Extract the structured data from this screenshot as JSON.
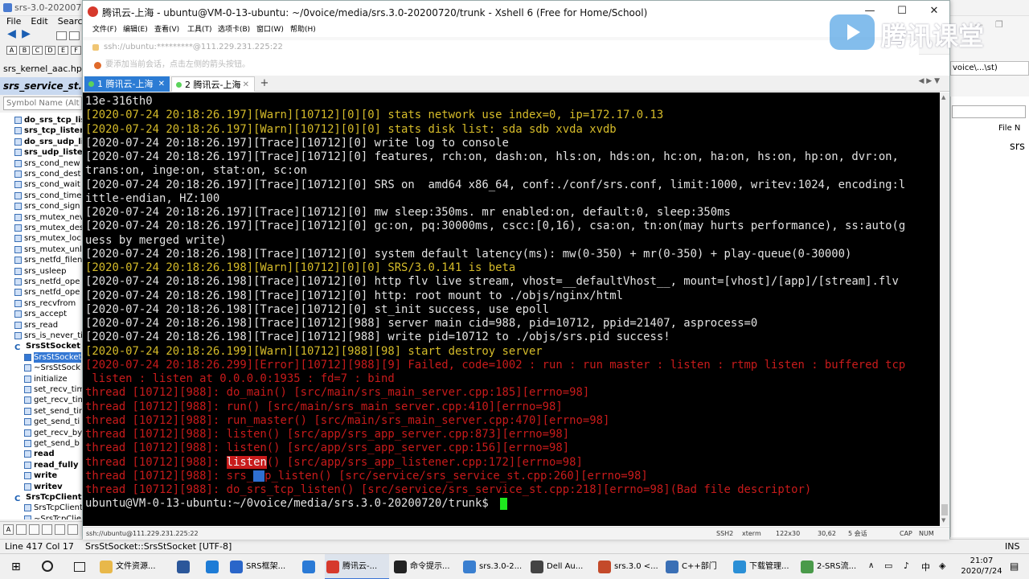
{
  "background_app": {
    "title": "srs-3.0-20200720",
    "menu": [
      "File",
      "Edit",
      "Searc"
    ],
    "file_tab": "srs_kernel_aac.hpp",
    "current_tab": "srs_service_st.cp",
    "symbol_search_placeholder": "Symbol Name (Alt",
    "symbols": [
      {
        "label": "do_srs_tcp_list",
        "bold": true,
        "kind": "fn"
      },
      {
        "label": "srs_tcp_listen",
        "bold": true,
        "kind": "fn"
      },
      {
        "label": "do_srs_udp_lis",
        "bold": true,
        "kind": "fn"
      },
      {
        "label": "srs_udp_listen",
        "bold": true,
        "kind": "fn"
      },
      {
        "label": "srs_cond_new",
        "bold": false,
        "kind": "fn"
      },
      {
        "label": "srs_cond_dest",
        "bold": false,
        "kind": "fn"
      },
      {
        "label": "srs_cond_wait",
        "bold": false,
        "kind": "fn"
      },
      {
        "label": "srs_cond_time",
        "bold": false,
        "kind": "fn"
      },
      {
        "label": "srs_cond_sign",
        "bold": false,
        "kind": "fn"
      },
      {
        "label": "srs_mutex_nev",
        "bold": false,
        "kind": "fn"
      },
      {
        "label": "srs_mutex_des",
        "bold": false,
        "kind": "fn"
      },
      {
        "label": "srs_mutex_loc",
        "bold": false,
        "kind": "fn"
      },
      {
        "label": "srs_mutex_unl",
        "bold": false,
        "kind": "fn"
      },
      {
        "label": "srs_netfd_filen",
        "bold": false,
        "kind": "fn"
      },
      {
        "label": "srs_usleep",
        "bold": false,
        "kind": "fn"
      },
      {
        "label": "srs_netfd_ope",
        "bold": false,
        "kind": "fn"
      },
      {
        "label": "srs_netfd_ope",
        "bold": false,
        "kind": "fn"
      },
      {
        "label": "srs_recvfrom",
        "bold": false,
        "kind": "fn"
      },
      {
        "label": "srs_accept",
        "bold": false,
        "kind": "fn"
      },
      {
        "label": "srs_read",
        "bold": false,
        "kind": "fn"
      },
      {
        "label": "srs_is_never_ti",
        "bold": false,
        "kind": "fn"
      },
      {
        "label": "SrsStSocket",
        "bold": true,
        "kind": "class"
      },
      {
        "label": "SrsStSocket",
        "bold": false,
        "kind": "member",
        "selected": true
      },
      {
        "label": "~SrsStSock",
        "bold": false,
        "kind": "member"
      },
      {
        "label": "initialize",
        "bold": false,
        "kind": "member"
      },
      {
        "label": "set_recv_tim",
        "bold": false,
        "kind": "member"
      },
      {
        "label": "get_recv_tim",
        "bold": false,
        "kind": "member"
      },
      {
        "label": "set_send_tim",
        "bold": false,
        "kind": "member"
      },
      {
        "label": "get_send_ti",
        "bold": false,
        "kind": "member"
      },
      {
        "label": "get_recv_by",
        "bold": false,
        "kind": "member"
      },
      {
        "label": "get_send_b",
        "bold": false,
        "kind": "member"
      },
      {
        "label": "read",
        "bold": true,
        "kind": "member"
      },
      {
        "label": "read_fully",
        "bold": true,
        "kind": "member"
      },
      {
        "label": "write",
        "bold": true,
        "kind": "member"
      },
      {
        "label": "writev",
        "bold": true,
        "kind": "member"
      },
      {
        "label": "SrsTcpClient",
        "bold": true,
        "kind": "class"
      },
      {
        "label": "SrsTcpClient",
        "bold": false,
        "kind": "member"
      },
      {
        "label": "~SrsTcpClie",
        "bold": false,
        "kind": "member"
      }
    ],
    "status": {
      "line_col": "Line 417  Col 17",
      "symbol": "SrsStSocket::SrsStSocket [UTF-8]",
      "mode": "INS"
    },
    "right_panel": {
      "tab": "voice\\...\\st)",
      "header": "File N",
      "value": "srs"
    }
  },
  "xshell": {
    "title": "腾讯云-上海 - ubuntu@VM-0-13-ubuntu: ~/0voice/media/srs.3.0-20200720/trunk - Xshell 6 (Free for Home/School)",
    "menu": [
      "文件(F)",
      "编辑(E)",
      "查看(V)",
      "工具(T)",
      "选项卡(B)",
      "窗口(W)",
      "帮助(H)"
    ],
    "address": "ssh://ubuntu:*********@111.229.231.225:22",
    "hint": "要添加当前会话，点击左侧的箭头按钮。",
    "tabs": [
      {
        "label": "1 腾讯云-上海",
        "active": true
      },
      {
        "label": "2 腾讯云-上海",
        "active": false
      }
    ],
    "add_tab": "+",
    "status": {
      "address": "ssh://ubuntu@111.229.231.225:22",
      "protocol": "SSH2",
      "term": "xterm",
      "size": "122x30",
      "pos": "30,62",
      "sessions": "5 会话",
      "cap": "CAP",
      "num": "NUM"
    }
  },
  "terminal": {
    "lines": [
      {
        "color": "w",
        "text": "13e-316th0"
      },
      {
        "color": "y",
        "text": "[2020-07-24 20:18:26.197][Warn][10712][0][0] stats network use index=0, ip=172.17.0.13"
      },
      {
        "color": "y",
        "text": "[2020-07-24 20:18:26.197][Warn][10712][0][0] stats disk list: sda sdb xvda xvdb"
      },
      {
        "color": "w",
        "text": "[2020-07-24 20:18:26.197][Trace][10712][0] write log to console"
      },
      {
        "color": "w",
        "text": "[2020-07-24 20:18:26.197][Trace][10712][0] features, rch:on, dash:on, hls:on, hds:on, hc:on, ha:on, hs:on, hp:on, dvr:on,"
      },
      {
        "color": "w",
        "text": "trans:on, inge:on, stat:on, sc:on"
      },
      {
        "color": "w",
        "text": "[2020-07-24 20:18:26.197][Trace][10712][0] SRS on  amd64 x86_64, conf:./conf/srs.conf, limit:1000, writev:1024, encoding:l"
      },
      {
        "color": "w",
        "text": "ittle-endian, HZ:100"
      },
      {
        "color": "w",
        "text": "[2020-07-24 20:18:26.197][Trace][10712][0] mw sleep:350ms. mr enabled:on, default:0, sleep:350ms"
      },
      {
        "color": "w",
        "text": "[2020-07-24 20:18:26.197][Trace][10712][0] gc:on, pq:30000ms, cscc:[0,16), csa:on, tn:on(may hurts performance), ss:auto(g"
      },
      {
        "color": "w",
        "text": "uess by merged write)"
      },
      {
        "color": "w",
        "text": "[2020-07-24 20:18:26.198][Trace][10712][0] system default latency(ms): mw(0-350) + mr(0-350) + play-queue(0-30000)"
      },
      {
        "color": "y",
        "text": "[2020-07-24 20:18:26.198][Warn][10712][0][0] SRS/3.0.141 is beta"
      },
      {
        "color": "w",
        "text": "[2020-07-24 20:18:26.198][Trace][10712][0] http flv live stream, vhost=__defaultVhost__, mount=[vhost]/[app]/[stream].flv"
      },
      {
        "color": "w",
        "text": "[2020-07-24 20:18:26.198][Trace][10712][0] http: root mount to ./objs/nginx/html"
      },
      {
        "color": "w",
        "text": "[2020-07-24 20:18:26.198][Trace][10712][0] st_init success, use epoll"
      },
      {
        "color": "w",
        "text": "[2020-07-24 20:18:26.198][Trace][10712][988] server main cid=988, pid=10712, ppid=21407, asprocess=0"
      },
      {
        "color": "w",
        "text": "[2020-07-24 20:18:26.198][Trace][10712][988] write pid=10712 to ./objs/srs.pid success!"
      },
      {
        "color": "y",
        "text": "[2020-07-24 20:18:26.199][Warn][10712][988][98] start destroy server"
      },
      {
        "color": "r",
        "text": "[2020-07-24 20:18:26.299][Error][10712][988][9] Failed, code=1002 : run : run master : listen : rtmp listen : buffered tcp"
      },
      {
        "color": "r",
        "text": " listen : listen at 0.0.0.0:1935 : fd=7 : bind"
      },
      {
        "color": "r",
        "text": "thread [10712][988]: do_main() [src/main/srs_main_server.cpp:185][errno=98]"
      },
      {
        "color": "r",
        "text": "thread [10712][988]: run() [src/main/srs_main_server.cpp:410][errno=98]"
      },
      {
        "color": "r",
        "text": "thread [10712][988]: run_master() [src/main/srs_main_server.cpp:470][errno=98]"
      },
      {
        "color": "r",
        "text": "thread [10712][988]: listen() [src/app/srs_app_server.cpp:873][errno=98]"
      },
      {
        "color": "r",
        "text": "thread [10712][988]: listen() [src/app/srs_app_server.cpp:156][errno=98]"
      },
      {
        "color": "r",
        "text": "thread [10712][988]: ",
        "hl": "listen",
        "rest": "() [src/app/srs_app_listener.cpp:172][errno=98]"
      },
      {
        "color": "r",
        "text": "thread [10712][988]: srs_",
        "cursor_block": true,
        "rest": "p_listen() [src/service/srs_service_st.cpp:260][errno=98]"
      },
      {
        "color": "r",
        "text": "thread [10712][988]: do_srs_tcp_listen() [src/service/srs_service_st.cpp:218][errno=98](Bad file descriptor)"
      },
      {
        "color": "w",
        "text": "ubuntu@VM-0-13-ubuntu:~/0voice/media/srs.3.0-20200720/trunk$ ",
        "prompt": true
      }
    ]
  },
  "watermark": {
    "text": "腾讯课堂"
  },
  "taskbar": {
    "items": [
      {
        "label": "文件资源...",
        "color": "#e8b84a"
      },
      {
        "label": "",
        "color": "#2b579a"
      },
      {
        "label": "",
        "color": "#1e7cd6"
      },
      {
        "label": "SRS框架...",
        "color": "#2a66c9"
      },
      {
        "label": "",
        "color": "#2a7ad6"
      },
      {
        "label": "腾讯云-...",
        "color": "#d6392c",
        "active": true
      },
      {
        "label": "命令提示...",
        "color": "#222222"
      },
      {
        "label": "srs.3.0-2...",
        "color": "#3a7fd0"
      },
      {
        "label": "Dell Au...",
        "color": "#444444"
      },
      {
        "label": "srs.3.0 <...",
        "color": "#c44a2a"
      },
      {
        "label": "C++部门",
        "color": "#3a6fb5"
      },
      {
        "label": "下载管理...",
        "color": "#2a8fd6"
      },
      {
        "label": "2-SRS流...",
        "color": "#4a9a4a"
      }
    ],
    "time": "21:07",
    "date": "2020/7/24"
  }
}
